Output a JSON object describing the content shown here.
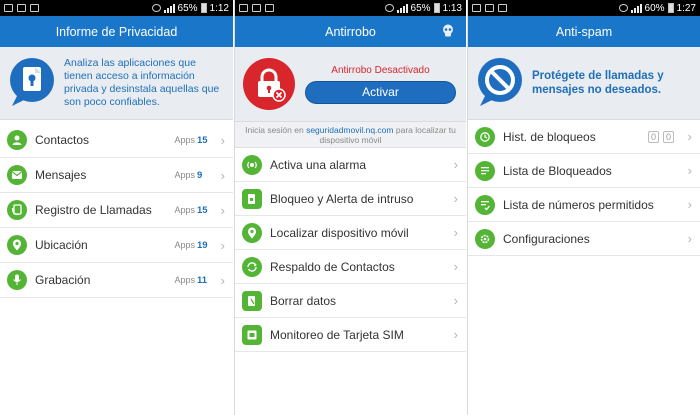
{
  "status_bars": [
    {
      "battery": "65%",
      "time": "1:12"
    },
    {
      "battery": "65%",
      "time": "1:13"
    },
    {
      "battery": "60%",
      "time": "1:27"
    }
  ],
  "privacy": {
    "title": "Informe de Privacidad",
    "promo": "Analiza las aplicaciones que tienen acceso a información privada y desinstala aquellas que son poco confiables.",
    "apps_label": "Apps",
    "items": [
      {
        "label": "Contactos",
        "count": "15",
        "icon": "contacts-icon"
      },
      {
        "label": "Mensajes",
        "count": "9",
        "icon": "messages-icon"
      },
      {
        "label": "Registro de Llamadas",
        "count": "15",
        "icon": "call-log-icon"
      },
      {
        "label": "Ubicación",
        "count": "19",
        "icon": "location-icon"
      },
      {
        "label": "Grabación",
        "count": "11",
        "icon": "microphone-icon"
      }
    ]
  },
  "antitheft": {
    "title": "Antirrobo",
    "status": "Antirrobo Desactivado",
    "activate_label": "Activar",
    "login_prefix": "Inicia sesión en",
    "login_link": "seguridadmovil.nq.com",
    "login_suffix": "para localizar tu dispositivo móvil",
    "items": [
      {
        "label": "Activa una alarma",
        "icon": "alarm-icon"
      },
      {
        "label": "Bloqueo y Alerta de intruso",
        "icon": "lock-alert-icon"
      },
      {
        "label": "Localizar dispositivo móvil",
        "icon": "locate-icon"
      },
      {
        "label": "Respaldo de Contactos",
        "icon": "backup-icon"
      },
      {
        "label": "Borrar datos",
        "icon": "wipe-icon"
      },
      {
        "label": "Monitoreo de Tarjeta SIM",
        "icon": "sim-card-icon"
      }
    ]
  },
  "antispam": {
    "title": "Anti-spam",
    "promo": "Protégete de llamadas y mensajes no deseados.",
    "items": [
      {
        "label": "Hist. de bloqueos",
        "icon": "block-history-icon",
        "extra": [
          "0",
          "0"
        ]
      },
      {
        "label": "Lista de Bloqueados",
        "icon": "blocked-list-icon"
      },
      {
        "label": "Lista de números permitidos",
        "icon": "allowed-list-icon"
      },
      {
        "label": "Configuraciones",
        "icon": "settings-icon"
      }
    ]
  },
  "colors": {
    "accent": "#1976c8",
    "green": "#53b436",
    "alert_red": "#d9262c"
  }
}
